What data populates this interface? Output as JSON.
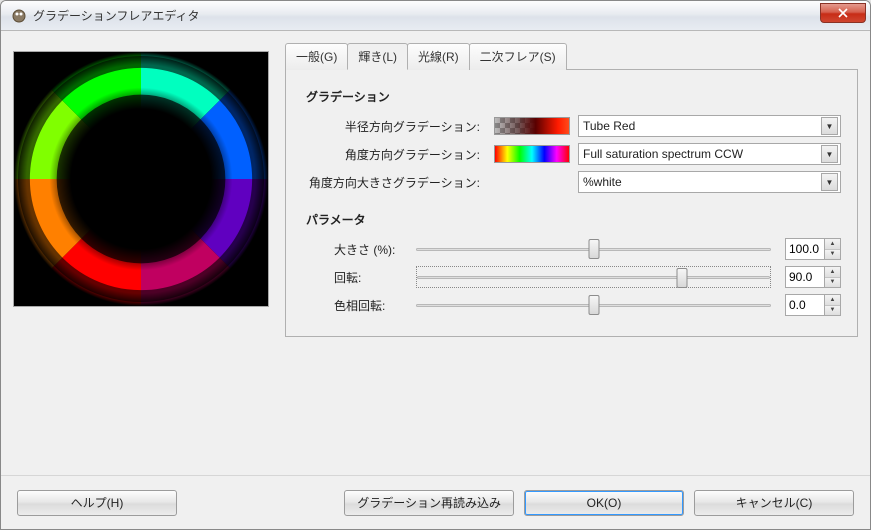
{
  "window": {
    "title": "グラデーションフレアエディタ"
  },
  "tabs": {
    "general": "一般(G)",
    "glow": "輝き(L)",
    "rays": "光線(R)",
    "secondflare": "二次フレア(S)",
    "active": "glow"
  },
  "sections": {
    "gradation": "グラデーション",
    "parameters": "パラメータ"
  },
  "gradation": {
    "radial_label": "半径方向グラデーション:",
    "angular_label": "角度方向グラデーション:",
    "angular_size_label": "角度方向大きさグラデーション:",
    "radial_value": "Tube Red",
    "angular_value": "Full saturation spectrum CCW",
    "angular_size_value": "%white"
  },
  "params": {
    "size_label": "大きさ (%):",
    "rotation_label": "回転:",
    "hue_rotation_label": "色相回転:",
    "size_value": "100.0",
    "rotation_value": "90.0",
    "hue_rotation_value": "0.0",
    "size_pos": 50,
    "rotation_pos": 75,
    "hue_rotation_pos": 50
  },
  "footer": {
    "help": "ヘルプ(H)",
    "reread": "グラデーション再読み込み",
    "ok": "OK(O)",
    "cancel": "キャンセル(C)"
  },
  "chart_data": {
    "type": "other",
    "description": "Gradient flare ring preview",
    "title": "",
    "series": []
  }
}
